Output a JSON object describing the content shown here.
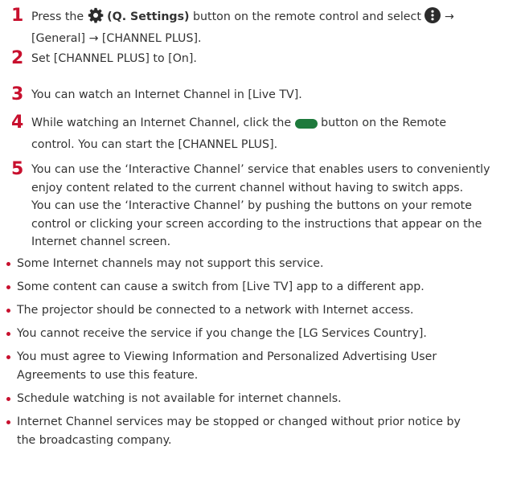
{
  "steps": [
    {
      "number": "1",
      "before_settings": "Press the",
      "settings_label": "(Q. Settings)",
      "after_settings": "button on the remote control and select",
      "arrow": "→",
      "line2": "[General] → [CHANNEL PLUS]."
    },
    {
      "number": "2",
      "text": "Set [CHANNEL PLUS] to [On]."
    },
    {
      "number": "3",
      "text": "You can watch an Internet Channel in [Live TV]."
    },
    {
      "number": "4",
      "before_button": "While watching an Internet Channel, click the",
      "after_button": "button on the Remote",
      "line2": "control. You can start the [CHANNEL PLUS]."
    },
    {
      "number": "5",
      "lines": [
        "You can use the ‘Interactive Channel’ service that enables users to conveniently",
        "enjoy content related to the current channel without having to switch apps.",
        "You can use the ‘Interactive Channel’ by pushing the buttons on your remote",
        "control or clicking your screen according to the instructions that appear on the",
        "Internet channel screen."
      ]
    }
  ],
  "notes": [
    {
      "lines": [
        "Some Internet channels may not support this service."
      ]
    },
    {
      "lines": [
        "Some content can cause a switch from [Live TV] app to a different app."
      ]
    },
    {
      "lines": [
        "The projector should be connected to a network with Internet access."
      ]
    },
    {
      "lines": [
        "You cannot receive the service if you change the [LG Services Country]."
      ]
    },
    {
      "lines": [
        "You must agree to Viewing Information and Personalized Advertising User",
        "Agreements to use this feature."
      ]
    },
    {
      "lines": [
        "Schedule watching is not available for internet channels."
      ]
    },
    {
      "lines": [
        "Internet Channel services may be stopped or changed without prior notice by",
        "the broadcasting company."
      ]
    }
  ],
  "icons": {
    "settings": "gear-icon",
    "more": "more-vertical-icon",
    "green_button": "green-button-icon"
  },
  "colors": {
    "accent": "#c8102e",
    "text": "#333333",
    "icon_dark": "#2b2b2b",
    "green": "#1e7a3c"
  }
}
